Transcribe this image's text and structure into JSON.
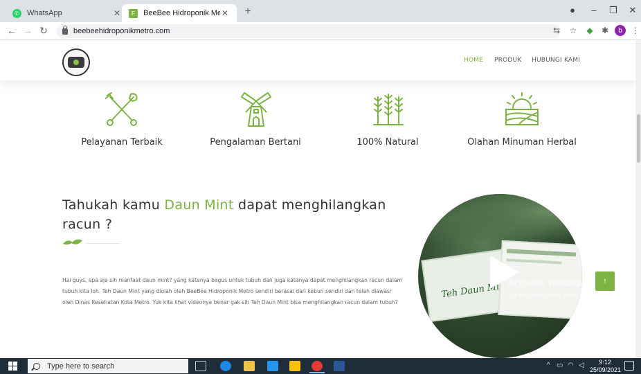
{
  "browser": {
    "tabs": [
      {
        "title": "WhatsApp",
        "active": false
      },
      {
        "title": "BeeBee Hidroponik Metro",
        "active": true
      }
    ],
    "url": "beebeehidroponikmetro.com"
  },
  "site": {
    "nav": [
      "HOME",
      "PRODUK",
      "HUBUNGI KAMI"
    ],
    "features": [
      {
        "label": "Pelayanan Terbaik",
        "icon": "shovel-fork-icon"
      },
      {
        "label": "Pengalaman Bertani",
        "icon": "windmill-icon"
      },
      {
        "label": "100% Natural",
        "icon": "wheat-icon"
      },
      {
        "label": "Olahan Minuman Herbal",
        "icon": "sunrise-field-icon"
      }
    ],
    "headline": {
      "part1": "Tahukah kamu ",
      "accent": "Daun Mint",
      "part2": " dapat menghilangkan racun ?"
    },
    "body": "Hai guys, apa aja sih manfaat daun mint? yang katanya bagus untuk tubuh dan juga katanya dapat menghilangkan racun dalam tubuh kita loh. Teh Daun Mint yang diolah oleh BeeBee Hidroponik Metro sendiri berasal dari kebun sendiri dan telah diawasi oleh Dinas Kesehatan Kota Metro. Yuk kita lihat videonya benar gak sih Teh Daun Mint bisa menghilangkan racun dalam tubuh?",
    "video_label": "Teh Daun Mint",
    "watermark_title": "Activate Windows",
    "watermark_sub": "Go to Settings to activate Windows."
  },
  "taskbar": {
    "search_placeholder": "Type here to search",
    "time": "9:12",
    "date": "25/09/2021"
  },
  "colors": {
    "accent": "#7cb342",
    "taskbar": "#1f2d3a"
  }
}
